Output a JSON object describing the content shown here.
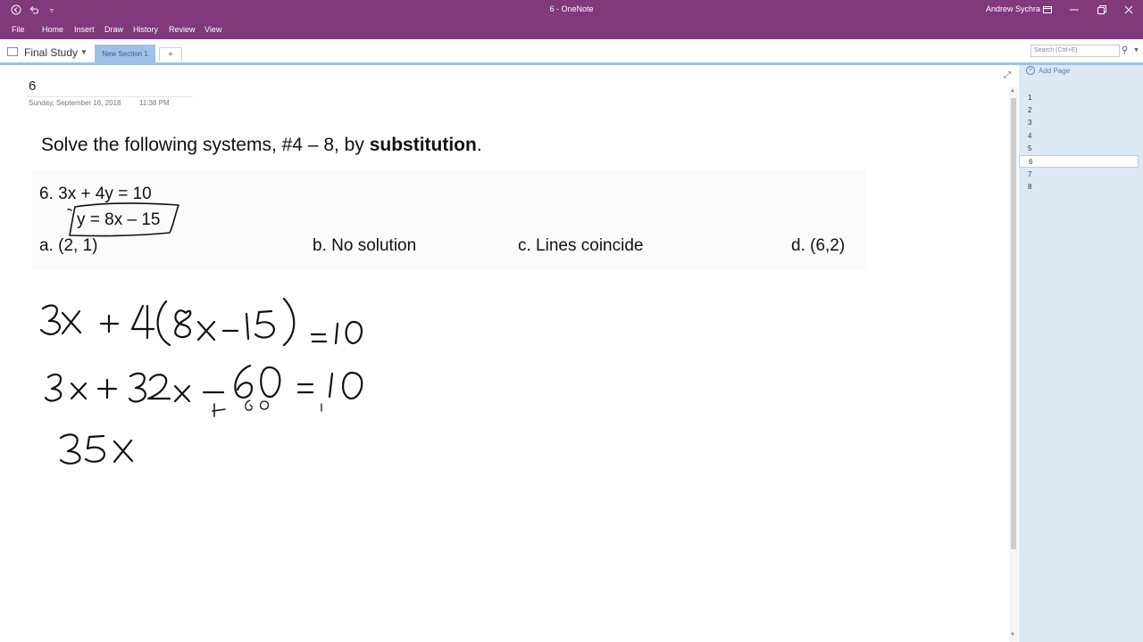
{
  "window": {
    "title": "6  -  OneNote",
    "user": "Andrew Sychra"
  },
  "ribbon": {
    "tabs": [
      "File",
      "Home",
      "Insert",
      "Draw",
      "History",
      "Review",
      "View"
    ]
  },
  "notebook": {
    "name": "Final Study",
    "active_section": "New Section 1",
    "add_section_label": "+"
  },
  "search": {
    "placeholder": "Search (Ctrl+E)"
  },
  "page": {
    "title": "6",
    "date": "Sunday, September 16, 2018",
    "time": "11:38 PM",
    "instruction_prefix": "Solve the following systems, #4 – 8, by ",
    "instruction_bold": "substitution",
    "instruction_suffix": ".",
    "problem": {
      "line1": "6.  3x + 4y = 10",
      "line2": "y = 8x – 15",
      "choices": [
        "a.  (2, 1)",
        "b.  No solution",
        "c.  Lines coincide",
        "d.  (6,2)"
      ]
    }
  },
  "page_list": {
    "add_page_label": "Add Page",
    "items": [
      "1",
      "2",
      "3",
      "4",
      "5",
      "6",
      "7",
      "8"
    ],
    "selected": "6"
  },
  "colors": {
    "title_bar": "#80397b",
    "section_tab": "#9fc1e6",
    "page_pane": "#dce8f4"
  }
}
